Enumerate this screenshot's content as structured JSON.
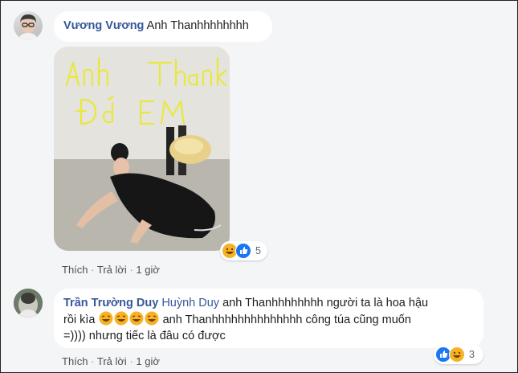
{
  "comments": [
    {
      "author": "Vương Vương",
      "text": "Anh Thanhhhhhhhh",
      "reaction_count": "5",
      "actions": {
        "like": "Thích",
        "reply": "Trả lời",
        "time": "1 giờ",
        "sep": "·"
      }
    },
    {
      "author": "Trần Trường Duy",
      "tag": "Huỳnh Duy",
      "text_line1": "anh Thanhhhhhhhh người ta là hoa hậu",
      "text_line2_prefix": "rồi kìa",
      "text_line2_suffix": "anh Thanhhhhhhhhhhhhhh công túa cũng muốn",
      "text_line3": "=)))) nhưng tiếc là đâu có được",
      "reaction_count": "3",
      "actions": {
        "like": "Thích",
        "reply": "Trả lời",
        "time": "1 giờ",
        "sep": "·"
      }
    }
  ],
  "photo": {
    "handwriting_line1": "Anh Thanh",
    "handwriting_line2": "đỡ EM"
  },
  "icons": {
    "laugh": "laugh-reaction-icon",
    "like": "like-reaction-icon"
  },
  "colors": {
    "name": "#365899",
    "like_blue": "#1877f2",
    "laugh_yellow": "#f7b125"
  }
}
